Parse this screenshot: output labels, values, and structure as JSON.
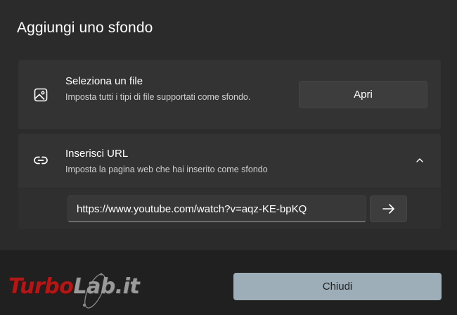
{
  "dialog": {
    "title": "Aggiungi uno sfondo"
  },
  "file_card": {
    "icon": "image-icon",
    "title": "Seleziona un file",
    "description": "Imposta tutti i tipi di file supportati come sfondo.",
    "button_label": "Apri"
  },
  "url_card": {
    "icon": "link-icon",
    "title": "Inserisci URL",
    "description": "Imposta la pagina web che hai inserito come sfondo",
    "expanded": true,
    "chevron_icon": "chevron-up-icon",
    "input_value": "https://www.youtube.com/watch?v=aqz-KE-bpKQ",
    "go_icon": "arrow-right-icon"
  },
  "footer": {
    "close_label": "Chiudi"
  },
  "watermark": {
    "part1": "Turbo",
    "part2": "Lab.it"
  },
  "colors": {
    "background": "#202020",
    "content": "#2b2b2b",
    "card": "#333333",
    "accent_button": "#9eaeb8",
    "watermark_red": "#b01818"
  }
}
